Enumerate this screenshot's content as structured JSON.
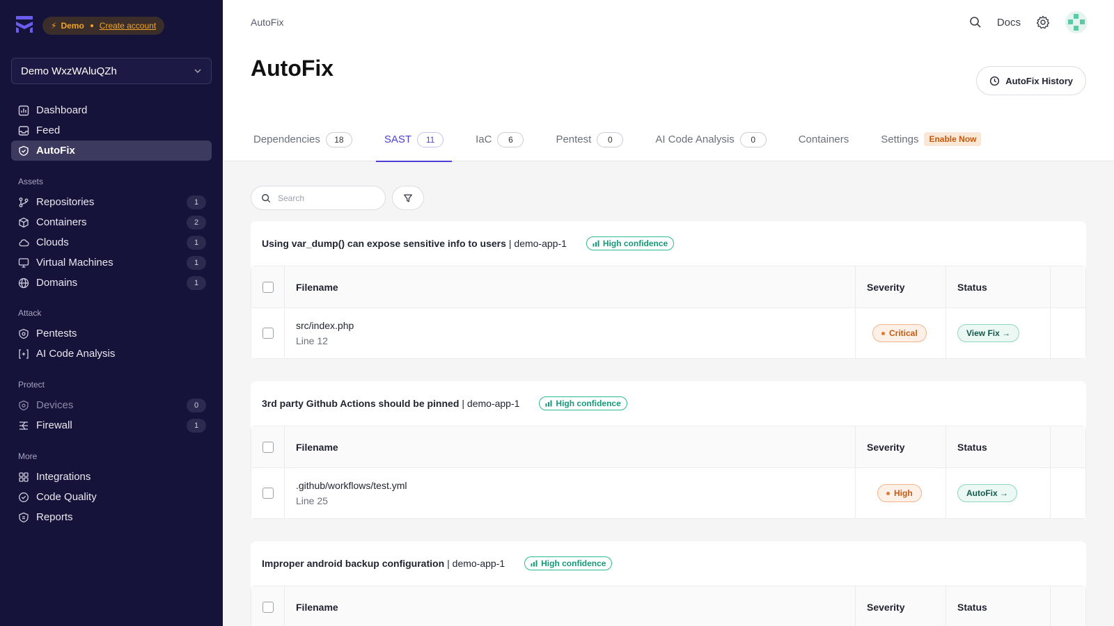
{
  "demo": {
    "label": "Demo",
    "link": "Create account"
  },
  "workspace": {
    "name": "Demo WxzWAluQZh"
  },
  "nav_main": [
    {
      "label": "Dashboard",
      "icon": "dashboard-icon"
    },
    {
      "label": "Feed",
      "icon": "inbox-icon"
    },
    {
      "label": "AutoFix",
      "icon": "shield-check-icon",
      "active": true
    }
  ],
  "sections": {
    "assets": "Assets",
    "attack": "Attack",
    "protect": "Protect",
    "more": "More"
  },
  "nav_assets": [
    {
      "label": "Repositories",
      "count": "1"
    },
    {
      "label": "Containers",
      "count": "2"
    },
    {
      "label": "Clouds",
      "count": "1"
    },
    {
      "label": "Virtual Machines",
      "count": "1"
    },
    {
      "label": "Domains",
      "count": "1"
    }
  ],
  "nav_attack": [
    {
      "label": "Pentests"
    },
    {
      "label": "AI Code Analysis"
    }
  ],
  "nav_protect": [
    {
      "label": "Devices",
      "count": "0"
    },
    {
      "label": "Firewall",
      "count": "1"
    }
  ],
  "nav_more": [
    {
      "label": "Integrations"
    },
    {
      "label": "Code Quality"
    },
    {
      "label": "Reports"
    }
  ],
  "header": {
    "crumb": "AutoFix",
    "docs": "Docs",
    "title": "AutoFix",
    "history": "AutoFix History"
  },
  "tabs": [
    {
      "label": "Dependencies",
      "count": "18"
    },
    {
      "label": "SAST",
      "count": "11",
      "active": true
    },
    {
      "label": "IaC",
      "count": "6"
    },
    {
      "label": "Pentest",
      "count": "0"
    },
    {
      "label": "AI Code Analysis",
      "count": "0"
    },
    {
      "label": "Containers"
    },
    {
      "label": "Settings",
      "badge": "Enable Now"
    }
  ],
  "search": {
    "placeholder": "Search"
  },
  "columns": {
    "filename": "Filename",
    "severity": "Severity",
    "status": "Status"
  },
  "issues": [
    {
      "title": "Using var_dump() can expose sensitive info to users",
      "repo": "| demo-app-1",
      "confidence": "High confidence",
      "file": "src/index.php",
      "line": "Line 12",
      "severity": "Critical",
      "status": "View Fix →"
    },
    {
      "title": "3rd party Github Actions should be pinned",
      "repo": "| demo-app-1",
      "confidence": "High confidence",
      "file": ".github/workflows/test.yml",
      "line": "Line 25",
      "severity": "High",
      "status": "AutoFix →"
    },
    {
      "title": "Improper android backup configuration",
      "repo": "| demo-app-1",
      "confidence": "High confidence"
    }
  ],
  "colors": {
    "sidebar": "#16133a",
    "accent": "#4b3fd6",
    "confidence": "#149a78",
    "severity": "#c55a14"
  }
}
